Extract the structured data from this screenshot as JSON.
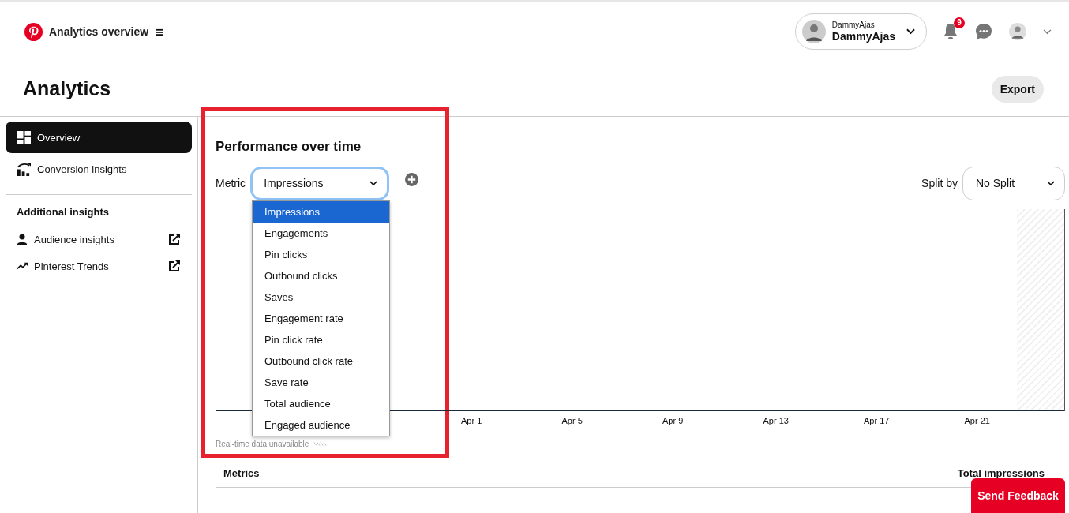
{
  "header": {
    "title": "Analytics overview",
    "account": {
      "small_name": "DammyAjas",
      "name": "DammyAjas"
    },
    "notifications": {
      "count": "9"
    }
  },
  "page": {
    "title": "Analytics",
    "export_button": "Export"
  },
  "sidebar": {
    "items": [
      {
        "label": "Overview",
        "selected": true
      },
      {
        "label": "Conversion insights",
        "selected": false
      }
    ],
    "section_title": "Additional insights",
    "links": [
      {
        "label": "Audience insights"
      },
      {
        "label": "Pinterest Trends"
      }
    ]
  },
  "performance": {
    "title": "Performance over time",
    "metric_label": "Metric",
    "metric_value": "Impressions",
    "metric_options": [
      {
        "label": "Impressions",
        "selected": true
      },
      {
        "label": "Engagements",
        "selected": false
      },
      {
        "label": "Pin clicks",
        "selected": false
      },
      {
        "label": "Outbound clicks",
        "selected": false
      },
      {
        "label": "Saves",
        "selected": false
      },
      {
        "label": "Engagement rate",
        "selected": false
      },
      {
        "label": "Pin click rate",
        "selected": false
      },
      {
        "label": "Outbound click rate",
        "selected": false
      },
      {
        "label": "Save rate",
        "selected": false
      },
      {
        "label": "Total audience",
        "selected": false
      },
      {
        "label": "Engaged audience",
        "selected": false
      }
    ],
    "split_label": "Split by",
    "split_value": "No Split",
    "x_labels": [
      "Apr 1",
      "Apr 5",
      "Apr 9",
      "Apr 13",
      "Apr 17",
      "Apr 21"
    ],
    "note": "Real-time data unavailable"
  },
  "metrics": {
    "title": "Metrics",
    "column": "Total impressions"
  },
  "feedback_button": "Send Feedback"
}
